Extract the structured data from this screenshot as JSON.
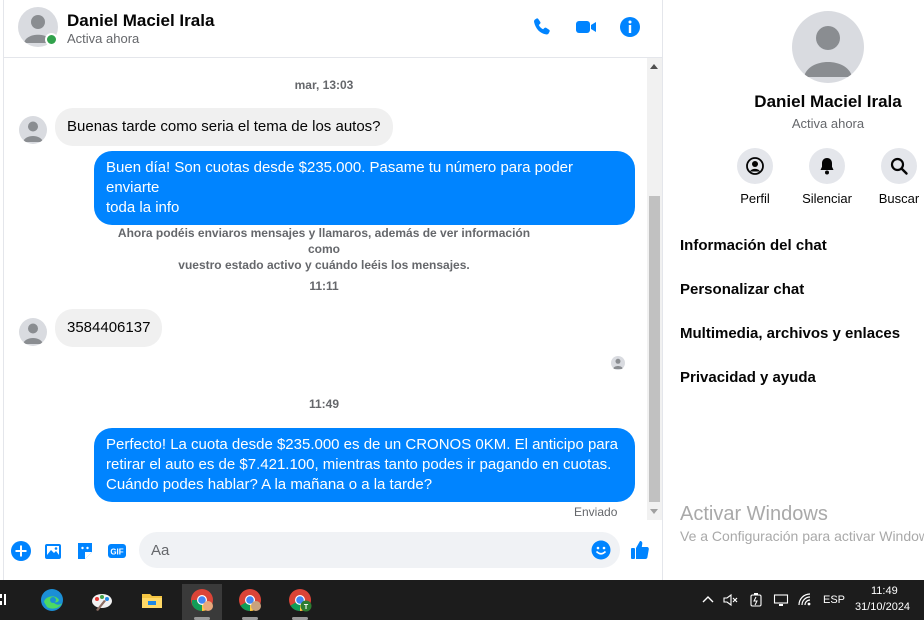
{
  "header": {
    "name": "Daniel Maciel Irala",
    "status": "Activa ahora",
    "icons": [
      "phone-icon",
      "video-icon",
      "info-icon"
    ],
    "accent": "#0084ff"
  },
  "messages": {
    "timestamp_1": "mar, 13:03",
    "incoming_1": "Buenas tarde como seria el tema de los autos?",
    "outgoing_1_line1": "Buen día! Son cuotas desde $235.000. Pasame tu número para poder enviarte",
    "outgoing_1_line2": "toda la info",
    "system_note_line1": "Ahora podéis enviaros mensajes y llamaros, además de ver información como",
    "system_note_line2": "vuestro estado activo y cuándo leéis los mensajes.",
    "timestamp_2": "11:11",
    "incoming_2": "3584406137",
    "timestamp_3": "11:49",
    "outgoing_2_line1": "Perfecto! La cuota desde $235.000 es de un CRONOS 0KM. El anticipo para",
    "outgoing_2_line2": "retirar el auto es de $7.421.100, mientras tanto podes ir pagando en cuotas.",
    "outgoing_2_line3": "Cuándo podes hablar? A la mañana o a la tarde?",
    "sent_status": "Enviado"
  },
  "composer": {
    "placeholder": "Aa",
    "icons": [
      "plus-icon",
      "image-icon",
      "sticker-icon",
      "gif-icon",
      "emoji-icon",
      "like-icon"
    ]
  },
  "info_panel": {
    "name": "Daniel Maciel Irala",
    "status": "Activa ahora",
    "actions": [
      {
        "label": "Perfil",
        "icon": "profile-icon"
      },
      {
        "label": "Silenciar",
        "icon": "bell-icon"
      },
      {
        "label": "Buscar",
        "icon": "search-icon"
      }
    ],
    "menu": [
      "Información del chat",
      "Personalizar chat",
      "Multimedia, archivos y enlaces",
      "Privacidad y ayuda"
    ],
    "watermark_title": "Activar Windows",
    "watermark_subtitle": "Ve a Configuración para activar Windows."
  },
  "taskbar": {
    "apps": [
      "edge-icon",
      "paint-icon",
      "file-explorer-icon",
      "chrome-icon",
      "chrome-profile-icon",
      "chrome-t-icon"
    ],
    "tray_icons": [
      "chevron-up-icon",
      "speaker-muted-icon",
      "battery-icon",
      "display-icon",
      "wifi-icon"
    ],
    "language": "ESP",
    "time": "11:49",
    "date": "31/10/2024"
  }
}
